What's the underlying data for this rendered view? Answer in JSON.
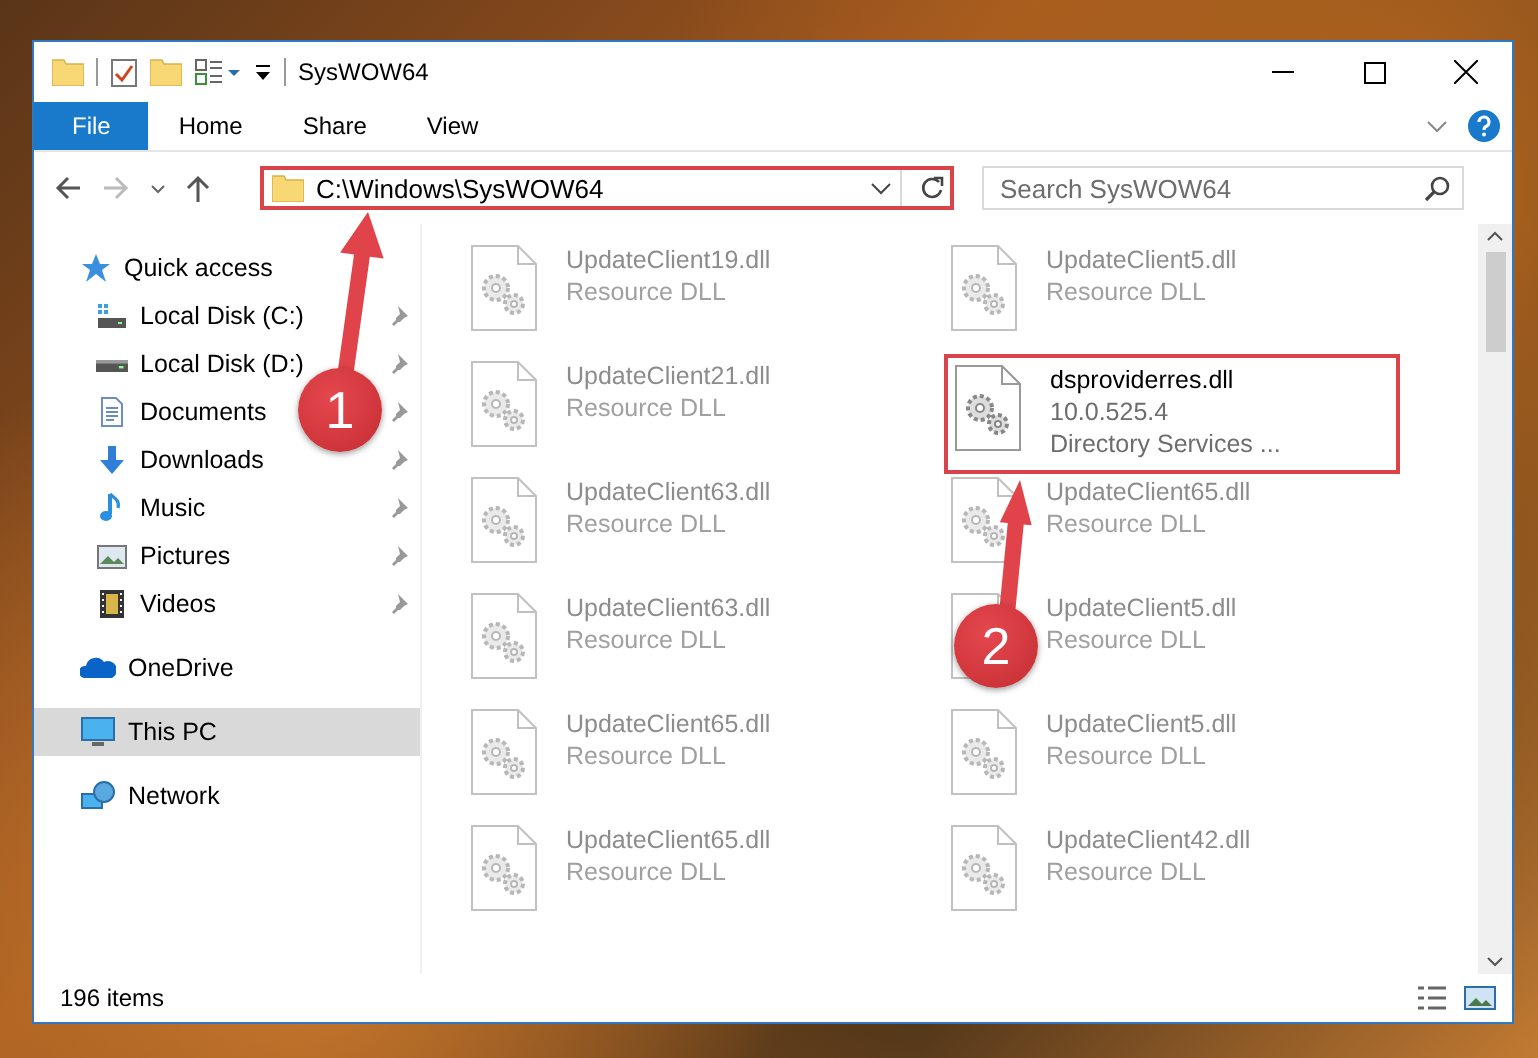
{
  "window": {
    "title": "SysWOW64"
  },
  "ribbon": {
    "tabs": [
      {
        "label": "File",
        "selected": true
      },
      {
        "label": "Home",
        "selected": false
      },
      {
        "label": "Share",
        "selected": false
      },
      {
        "label": "View",
        "selected": false
      }
    ]
  },
  "address_bar": {
    "path": "C:\\Windows\\SysWOW64",
    "highlighted": true
  },
  "search": {
    "placeholder": "Search SysWOW64"
  },
  "navigation": [
    {
      "label": "Quick access",
      "kind": "star",
      "selected": false,
      "children": [
        {
          "label": "Local Disk (C:)",
          "kind": "drive-c",
          "pinned": true,
          "selected": false
        },
        {
          "label": "Local Disk (D:)",
          "kind": "drive",
          "pinned": true,
          "selected": false
        },
        {
          "label": "Documents",
          "kind": "document",
          "pinned": true,
          "selected": false
        },
        {
          "label": "Downloads",
          "kind": "download",
          "pinned": true,
          "selected": false
        },
        {
          "label": "Music",
          "kind": "music",
          "pinned": true,
          "selected": false
        },
        {
          "label": "Pictures",
          "kind": "picture",
          "pinned": true,
          "selected": false
        },
        {
          "label": "Videos",
          "kind": "video",
          "pinned": true,
          "selected": false
        }
      ]
    },
    {
      "label": "OneDrive",
      "kind": "cloud",
      "selected": false
    },
    {
      "label": "This PC",
      "kind": "computer",
      "selected": true
    },
    {
      "label": "Network",
      "kind": "network",
      "selected": false
    }
  ],
  "files": [
    {
      "name": "UpdateClient19.dll",
      "details": [
        "Resource DLL"
      ],
      "blurred": true,
      "highlighted": false
    },
    {
      "name": "UpdateClient5.dll",
      "details": [
        "Resource DLL"
      ],
      "blurred": true,
      "highlighted": false
    },
    {
      "name": "UpdateClient21.dll",
      "details": [
        "Resource DLL"
      ],
      "blurred": true,
      "highlighted": false
    },
    {
      "name": "dsproviderres.dll",
      "details": [
        "10.0.525.4",
        "Directory Services ..."
      ],
      "blurred": false,
      "highlighted": true
    },
    {
      "name": "UpdateClient63.dll",
      "details": [
        "Resource DLL"
      ],
      "blurred": true,
      "highlighted": false
    },
    {
      "name": "UpdateClient65.dll",
      "details": [
        "Resource DLL"
      ],
      "blurred": true,
      "highlighted": false
    },
    {
      "name": "UpdateClient63.dll",
      "details": [
        "Resource DLL"
      ],
      "blurred": true,
      "highlighted": false
    },
    {
      "name": "UpdateClient5.dll",
      "details": [
        "Resource DLL"
      ],
      "blurred": true,
      "highlighted": false
    },
    {
      "name": "UpdateClient65.dll",
      "details": [
        "Resource DLL"
      ],
      "blurred": true,
      "highlighted": false
    },
    {
      "name": "UpdateClient5.dll",
      "details": [
        "Resource DLL"
      ],
      "blurred": true,
      "highlighted": false
    },
    {
      "name": "UpdateClient65.dll",
      "details": [
        "Resource DLL"
      ],
      "blurred": true,
      "highlighted": false
    },
    {
      "name": "UpdateClient42.dll",
      "details": [
        "Resource DLL"
      ],
      "blurred": true,
      "highlighted": false
    }
  ],
  "status_bar": {
    "item_count": "196 items"
  },
  "callouts": [
    {
      "label": "1"
    },
    {
      "label": "2"
    }
  ]
}
